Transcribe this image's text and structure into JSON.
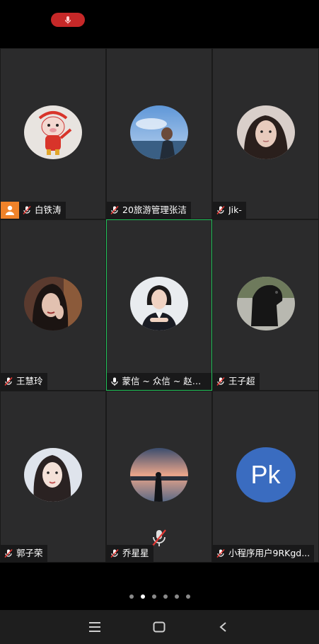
{
  "meeting": {
    "participants": [
      {
        "name": "白铁涛",
        "host": true,
        "muted": true,
        "avatar": "cartoon-pig"
      },
      {
        "name": "20旅游管理张洁",
        "muted": true,
        "avatar": "photo-sky"
      },
      {
        "name": "Jik-",
        "muted": true,
        "avatar": "photo-girl"
      },
      {
        "name": "王慧玲",
        "muted": true,
        "avatar": "photo-dark-hair"
      },
      {
        "name": "蒙信 ~ 众信 ~ 赵晓...",
        "muted": false,
        "speaking": true,
        "avatar": "photo-suit"
      },
      {
        "name": "王子超",
        "muted": true,
        "avatar": "photo-horse"
      },
      {
        "name": "郭子荣",
        "muted": true,
        "avatar": "photo-girl-light"
      },
      {
        "name": "乔星星",
        "muted": true,
        "avatar": "photo-sunset"
      },
      {
        "name": "小程序用户9RKgd...",
        "muted": true,
        "avatar_initials": "Pk"
      }
    ]
  },
  "pager": {
    "count": 6,
    "active_index": 1
  },
  "colors": {
    "tile_bg": "#2b2b2c",
    "active_border": "#21c35a",
    "host_badge": "#f0832a",
    "mute_red": "#c62828",
    "initials_bg": "#3a6cc0"
  }
}
